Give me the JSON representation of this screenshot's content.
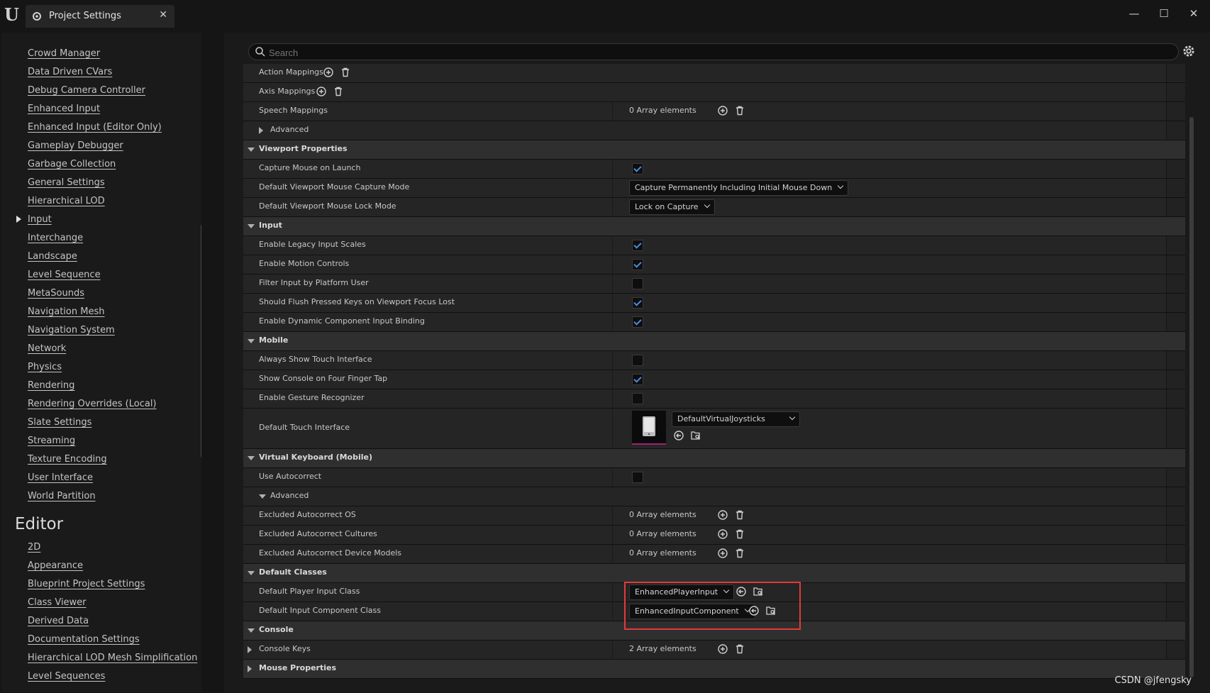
{
  "window": {
    "tab_title": "Project Settings"
  },
  "search": {
    "placeholder": "Search"
  },
  "sidebar": {
    "items": [
      "Crowd Manager",
      "Data Driven CVars",
      "Debug Camera Controller",
      "Enhanced Input",
      "Enhanced Input (Editor Only)",
      "Gameplay Debugger",
      "Garbage Collection",
      "General Settings",
      "Hierarchical LOD",
      "Input",
      "Interchange",
      "Landscape",
      "Level Sequence",
      "MetaSounds",
      "Navigation Mesh",
      "Navigation System",
      "Network",
      "Physics",
      "Rendering",
      "Rendering Overrides (Local)",
      "Slate Settings",
      "Streaming",
      "Texture Encoding",
      "User Interface",
      "World Partition"
    ],
    "editor_header": "Editor",
    "editor_items": [
      "2D",
      "Appearance",
      "Blueprint Project Settings",
      "Class Viewer",
      "Derived Data",
      "Documentation Settings",
      "Hierarchical LOD Mesh Simplification",
      "Level Sequences"
    ]
  },
  "rows": {
    "action_mappings": "Action Mappings",
    "axis_mappings": "Axis Mappings",
    "speech_mappings": "Speech Mappings",
    "speech_mappings_value": "0 Array elements",
    "advanced": "Advanced",
    "viewport_properties": "Viewport Properties",
    "capture_mouse_on_launch": "Capture Mouse on Launch",
    "default_viewport_mouse_capture_mode": "Default Viewport Mouse Capture Mode",
    "capture_mode_value": "Capture Permanently Including Initial Mouse Down",
    "default_viewport_mouse_lock_mode": "Default Viewport Mouse Lock Mode",
    "lock_mode_value": "Lock on Capture",
    "input": "Input",
    "enable_legacy_input_scales": "Enable Legacy Input Scales",
    "enable_motion_controls": "Enable Motion Controls",
    "filter_input_by_platform_user": "Filter Input by Platform User",
    "should_flush_pressed_keys": "Should Flush Pressed Keys on Viewport Focus Lost",
    "enable_dynamic_component_input_binding": "Enable Dynamic Component Input Binding",
    "mobile": "Mobile",
    "always_show_touch_interface": "Always Show Touch Interface",
    "show_console_on_four_finger_tap": "Show Console on Four Finger Tap",
    "enable_gesture_recognizer": "Enable Gesture Recognizer",
    "default_touch_interface": "Default Touch Interface",
    "touch_interface_value": "DefaultVirtualJoysticks",
    "virtual_keyboard_mobile": "Virtual Keyboard (Mobile)",
    "use_autocorrect": "Use Autocorrect",
    "excluded_autocorrect_os": "Excluded Autocorrect OS",
    "excluded_autocorrect_cultures": "Excluded Autocorrect Cultures",
    "excluded_autocorrect_device_models": "Excluded Autocorrect Device Models",
    "zero_array": "0 Array elements",
    "default_classes": "Default Classes",
    "default_player_input_class": "Default Player Input Class",
    "player_input_value": "EnhancedPlayerInput",
    "default_input_component_class": "Default Input Component Class",
    "input_component_value": "EnhancedInputComponent",
    "console": "Console",
    "console_keys": "Console Keys",
    "console_keys_value": "2 Array elements",
    "mouse_properties": "Mouse Properties"
  },
  "checkboxes": {
    "capture_mouse_on_launch": true,
    "enable_legacy_input_scales": true,
    "enable_motion_controls": true,
    "filter_input_by_platform_user": false,
    "should_flush_pressed_keys": true,
    "enable_dynamic_component_input_binding": true,
    "always_show_touch_interface": false,
    "show_console_on_four_finger_tap": true,
    "enable_gesture_recognizer": false,
    "use_autocorrect": false
  },
  "colors": {
    "highlight_box": "#e23a3a",
    "checkbox_accent": "#4a8ae0"
  },
  "watermark": "CSDN @jfengsky"
}
